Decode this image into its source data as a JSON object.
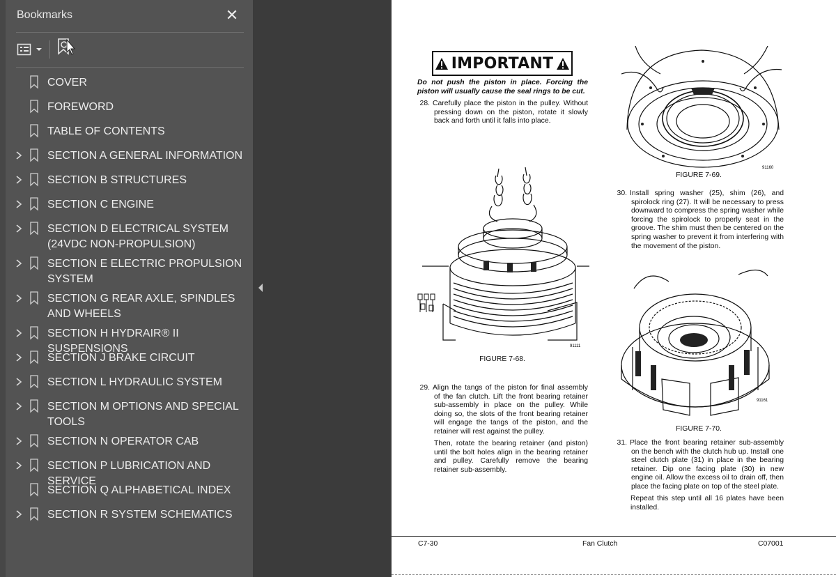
{
  "panel": {
    "title": "Bookmarks",
    "close_glyph": "✕",
    "toolbar": {
      "options_icon": "bookmark-options-icon",
      "find_icon": "find-current-bookmark-icon"
    },
    "items": [
      {
        "label": "COVER",
        "expandable": false
      },
      {
        "label": "FOREWORD",
        "expandable": false
      },
      {
        "label": "TABLE OF CONTENTS",
        "expandable": false
      },
      {
        "label": "SECTION A GENERAL INFORMATION",
        "expandable": true
      },
      {
        "label": "SECTION B STRUCTURES",
        "expandable": true
      },
      {
        "label": "SECTION C ENGINE",
        "expandable": true
      },
      {
        "label": "SECTION D ELECTRICAL SYSTEM (24VDC NON-PROPULSION)",
        "expandable": true
      },
      {
        "label": "SECTION E ELECTRIC PROPULSION SYSTEM",
        "expandable": true
      },
      {
        "label": "SECTION G REAR AXLE, SPINDLES AND WHEELS",
        "expandable": true
      },
      {
        "label": "SECTION H HYDRAIR® II SUSPENSIONS",
        "expandable": true
      },
      {
        "label": "SECTION J BRAKE CIRCUIT",
        "expandable": true
      },
      {
        "label": "SECTION L HYDRAULIC SYSTEM",
        "expandable": true
      },
      {
        "label": "SECTION M OPTIONS AND SPECIAL TOOLS",
        "expandable": true
      },
      {
        "label": "SECTION N OPERATOR CAB",
        "expandable": true
      },
      {
        "label": "SECTION P LUBRICATION AND SERVICE",
        "expandable": true
      },
      {
        "label": "SECTION Q ALPHABETICAL INDEX",
        "expandable": false
      },
      {
        "label": "SECTION R SYSTEM SCHEMATICS",
        "expandable": true
      }
    ]
  },
  "document": {
    "important": {
      "label": "IMPORTANT",
      "text": "Do not push the piston in place. Forcing the piston will usually cause the seal rings to be cut."
    },
    "steps": {
      "s28": {
        "num": "28.",
        "text": "Carefully place the piston in the pulley. Without pressing down on the piston, rotate it slowly back and forth until it falls into place."
      },
      "s29": {
        "num": "29.",
        "text": "Align the tangs of the piston for final assembly of the fan clutch. Lift the front bearing retainer sub-assembly in place on the pulley. While doing so, the slots of the front bearing retainer will engage the tangs of the piston, and the retainer will rest against the pulley."
      },
      "s29b": "Then, rotate the bearing retainer (and piston) until the bolt holes align in the bearing retainer and pulley. Carefully remove the bearing retainer sub-assembly.",
      "s30": {
        "num": "30.",
        "text": "Install spring washer (25), shim (26), and spirolock ring (27). It will be necessary to press downward to compress the spring washer while forcing the spirolock to properly seat in the groove. The shim must then be centered on the spring washer to prevent it from interfering with the movement of the piston."
      },
      "s31": {
        "num": "31.",
        "text": "Place the front bearing retainer sub-assembly on the bench with the clutch hub up. Install one steel clutch plate (31) in place in the bearing retainer. Dip one facing plate (30) in new engine oil. Allow the excess oil to drain off, then place the facing plate on top of the steel plate."
      },
      "s31b": "Repeat this step until all 16 plates have been installed."
    },
    "figures": {
      "f68": {
        "caption": "FIGURE 7-68.",
        "number": "91111"
      },
      "f69": {
        "caption": "FIGURE 7-69.",
        "number": "91160"
      },
      "f70": {
        "caption": "FIGURE 7-70.",
        "number": "91161"
      }
    },
    "footer": {
      "left": "C7-30",
      "center": "Fan Clutch",
      "right": "C07001"
    }
  }
}
